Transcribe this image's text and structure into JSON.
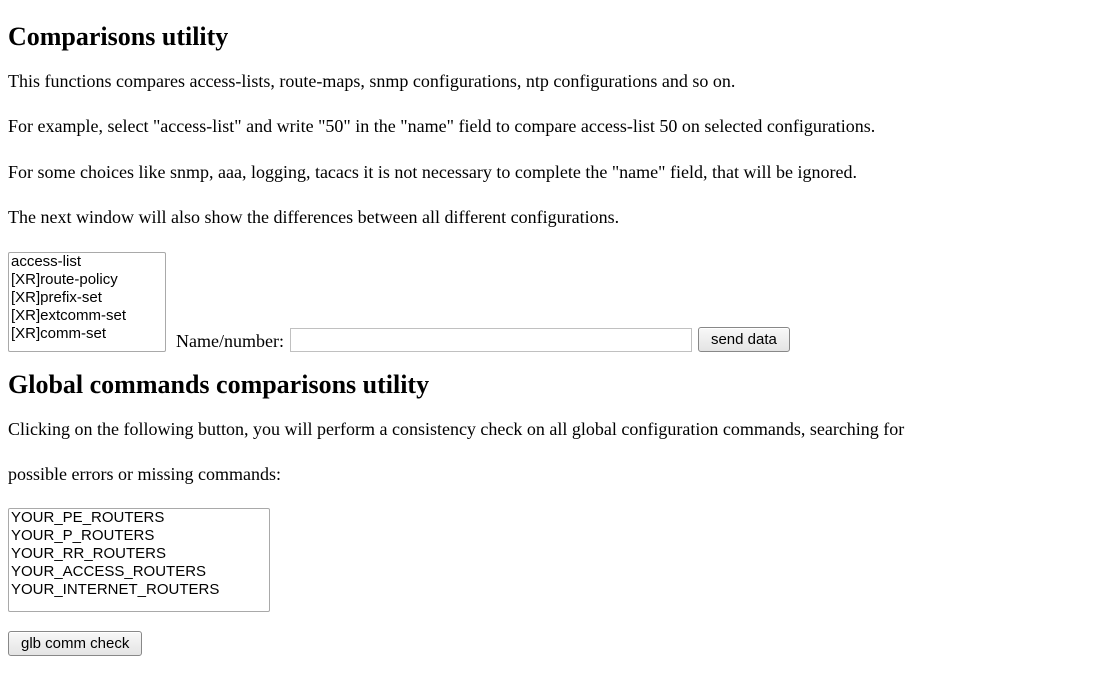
{
  "heading1": "Comparisons utility",
  "para1": "This functions compares access-lists, route-maps, snmp configurations, ntp configurations and so on.",
  "para2": "For example, select \"access-list\" and write \"50\" in the \"name\" field to compare access-list 50 on selected configurations.",
  "para3": "For some choices like snmp, aaa, logging, tacacs it is not necessary to complete the \"name\" field, that will be ignored.",
  "para4": "The next window will also show the differences between all different configurations.",
  "objecttype_options": [
    "access-list",
    "[XR]route-policy",
    "[XR]prefix-set",
    "[XR]extcomm-set",
    "[XR]comm-set"
  ],
  "name_label": "Name/number:",
  "name_value": "",
  "send_button": "send data",
  "heading2": "Global commands comparisons utility",
  "para5": "Clicking on the following button, you will perform a consistency check on all global configuration commands, searching for",
  "para6": "possible errors or missing commands:",
  "routers_options": [
    "YOUR_PE_ROUTERS",
    "YOUR_P_ROUTERS",
    "YOUR_RR_ROUTERS",
    "YOUR_ACCESS_ROUTERS",
    "YOUR_INTERNET_ROUTERS"
  ],
  "glb_button": "glb comm check"
}
